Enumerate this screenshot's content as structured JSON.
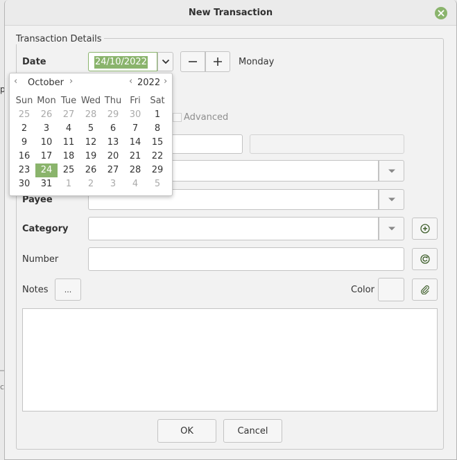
{
  "window": {
    "title": "New Transaction"
  },
  "frame": {
    "label": "Transaction Details"
  },
  "date": {
    "label": "Date",
    "value": "24/10/2022",
    "weekday": "Monday"
  },
  "advanced": {
    "label": "Advanced"
  },
  "payee": {
    "label": "Payee"
  },
  "category": {
    "label": "Category"
  },
  "number": {
    "label": "Number"
  },
  "notes": {
    "label": "Notes",
    "button": "..."
  },
  "color": {
    "label": "Color"
  },
  "buttons": {
    "ok": "OK",
    "cancel": "Cancel"
  },
  "calendar": {
    "month": "October",
    "year": "2022",
    "weekdays": [
      "Sun",
      "Mon",
      "Tue",
      "Wed",
      "Thu",
      "Fri",
      "Sat"
    ],
    "weeks": [
      [
        "25",
        "26",
        "27",
        "28",
        "29",
        "30",
        "1"
      ],
      [
        "2",
        "3",
        "4",
        "5",
        "6",
        "7",
        "8"
      ],
      [
        "9",
        "10",
        "11",
        "12",
        "13",
        "14",
        "15"
      ],
      [
        "16",
        "17",
        "18",
        "19",
        "20",
        "21",
        "22"
      ],
      [
        "23",
        "24",
        "25",
        "26",
        "27",
        "28",
        "29"
      ],
      [
        "30",
        "31",
        "1",
        "2",
        "3",
        "4",
        "5"
      ]
    ],
    "selected_day": "24"
  },
  "colors": {
    "accent": "#8ab46c"
  }
}
